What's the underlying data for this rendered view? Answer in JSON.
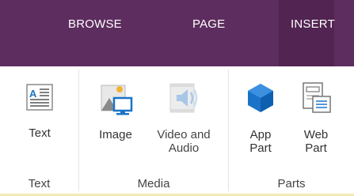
{
  "tabs": [
    {
      "label": "BROWSE",
      "active": false
    },
    {
      "label": "PAGE",
      "active": false
    },
    {
      "label": "INSERT",
      "active": true
    }
  ],
  "groups": [
    {
      "label": "Text",
      "buttons": [
        {
          "label": "Text",
          "icon": "text-box-icon"
        }
      ]
    },
    {
      "label": "Media",
      "buttons": [
        {
          "label": "Image",
          "icon": "image-icon"
        },
        {
          "label": "Video and\nAudio",
          "icon": "video-audio-icon",
          "disabled": true
        }
      ]
    },
    {
      "label": "Parts",
      "buttons": [
        {
          "label": "App\nPart",
          "icon": "app-part-icon"
        },
        {
          "label": "Web\nPart",
          "icon": "web-part-icon"
        }
      ]
    }
  ],
  "colors": {
    "tab_bar": "#5e2d5f",
    "active_tab": "#512451",
    "accent_blue": "#1a73c8"
  }
}
